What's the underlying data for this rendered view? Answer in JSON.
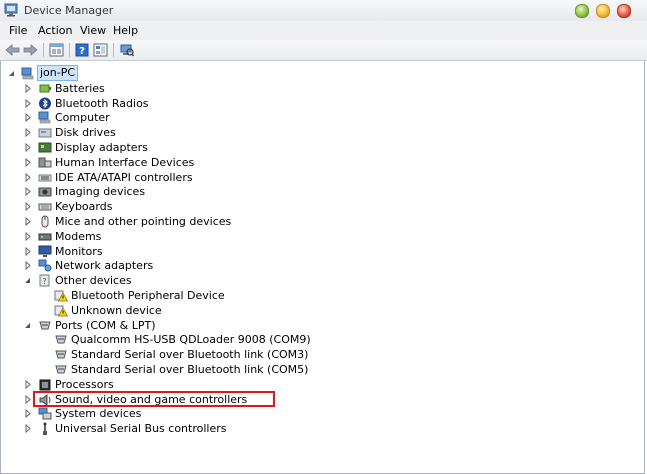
{
  "window": {
    "title": "Device Manager",
    "colors": {
      "highlight_box": "#e0161e",
      "selection": "#cde4fb"
    }
  },
  "menu": {
    "file": "File",
    "action": "Action",
    "view": "View",
    "help": "Help"
  },
  "toolbar": {
    "icons": [
      "back-arrow-icon",
      "forward-arrow-icon",
      "properties-icon",
      "help-icon",
      "show-hidden-icon",
      "scan-hardware-icon"
    ]
  },
  "tree": {
    "root": "jon-PC",
    "nodes": [
      {
        "label": "Batteries",
        "icon": "battery-icon"
      },
      {
        "label": "Bluetooth Radios",
        "icon": "bluetooth-icon"
      },
      {
        "label": "Computer",
        "icon": "computer-icon"
      },
      {
        "label": "Disk drives",
        "icon": "disk-icon"
      },
      {
        "label": "Display adapters",
        "icon": "display-icon"
      },
      {
        "label": "Human Interface Devices",
        "icon": "hid-icon"
      },
      {
        "label": "IDE ATA/ATAPI controllers",
        "icon": "ide-icon"
      },
      {
        "label": "Imaging devices",
        "icon": "camera-icon"
      },
      {
        "label": "Keyboards",
        "icon": "keyboard-icon"
      },
      {
        "label": "Mice and other pointing devices",
        "icon": "mouse-icon"
      },
      {
        "label": "Modems",
        "icon": "modem-icon"
      },
      {
        "label": "Monitors",
        "icon": "monitor-icon"
      },
      {
        "label": "Network adapters",
        "icon": "network-icon"
      },
      {
        "label": "Other devices",
        "icon": "other-devices-icon"
      },
      {
        "label": "Bluetooth Peripheral Device",
        "icon": "warning-icon"
      },
      {
        "label": "Unknown device",
        "icon": "warning-icon"
      },
      {
        "label": "Ports (COM & LPT)",
        "icon": "port-icon"
      },
      {
        "label": "Qualcomm HS-USB QDLoader 9008 (COM9)",
        "icon": "port-icon"
      },
      {
        "label": "Standard Serial over Bluetooth link (COM3)",
        "icon": "port-icon"
      },
      {
        "label": "Standard Serial over Bluetooth link (COM5)",
        "icon": "port-icon"
      },
      {
        "label": "Processors",
        "icon": "processor-icon"
      },
      {
        "label": "Sound, video and game controllers",
        "icon": "sound-icon"
      },
      {
        "label": "System devices",
        "icon": "system-icon"
      },
      {
        "label": "Universal Serial Bus controllers",
        "icon": "usb-icon"
      }
    ]
  }
}
